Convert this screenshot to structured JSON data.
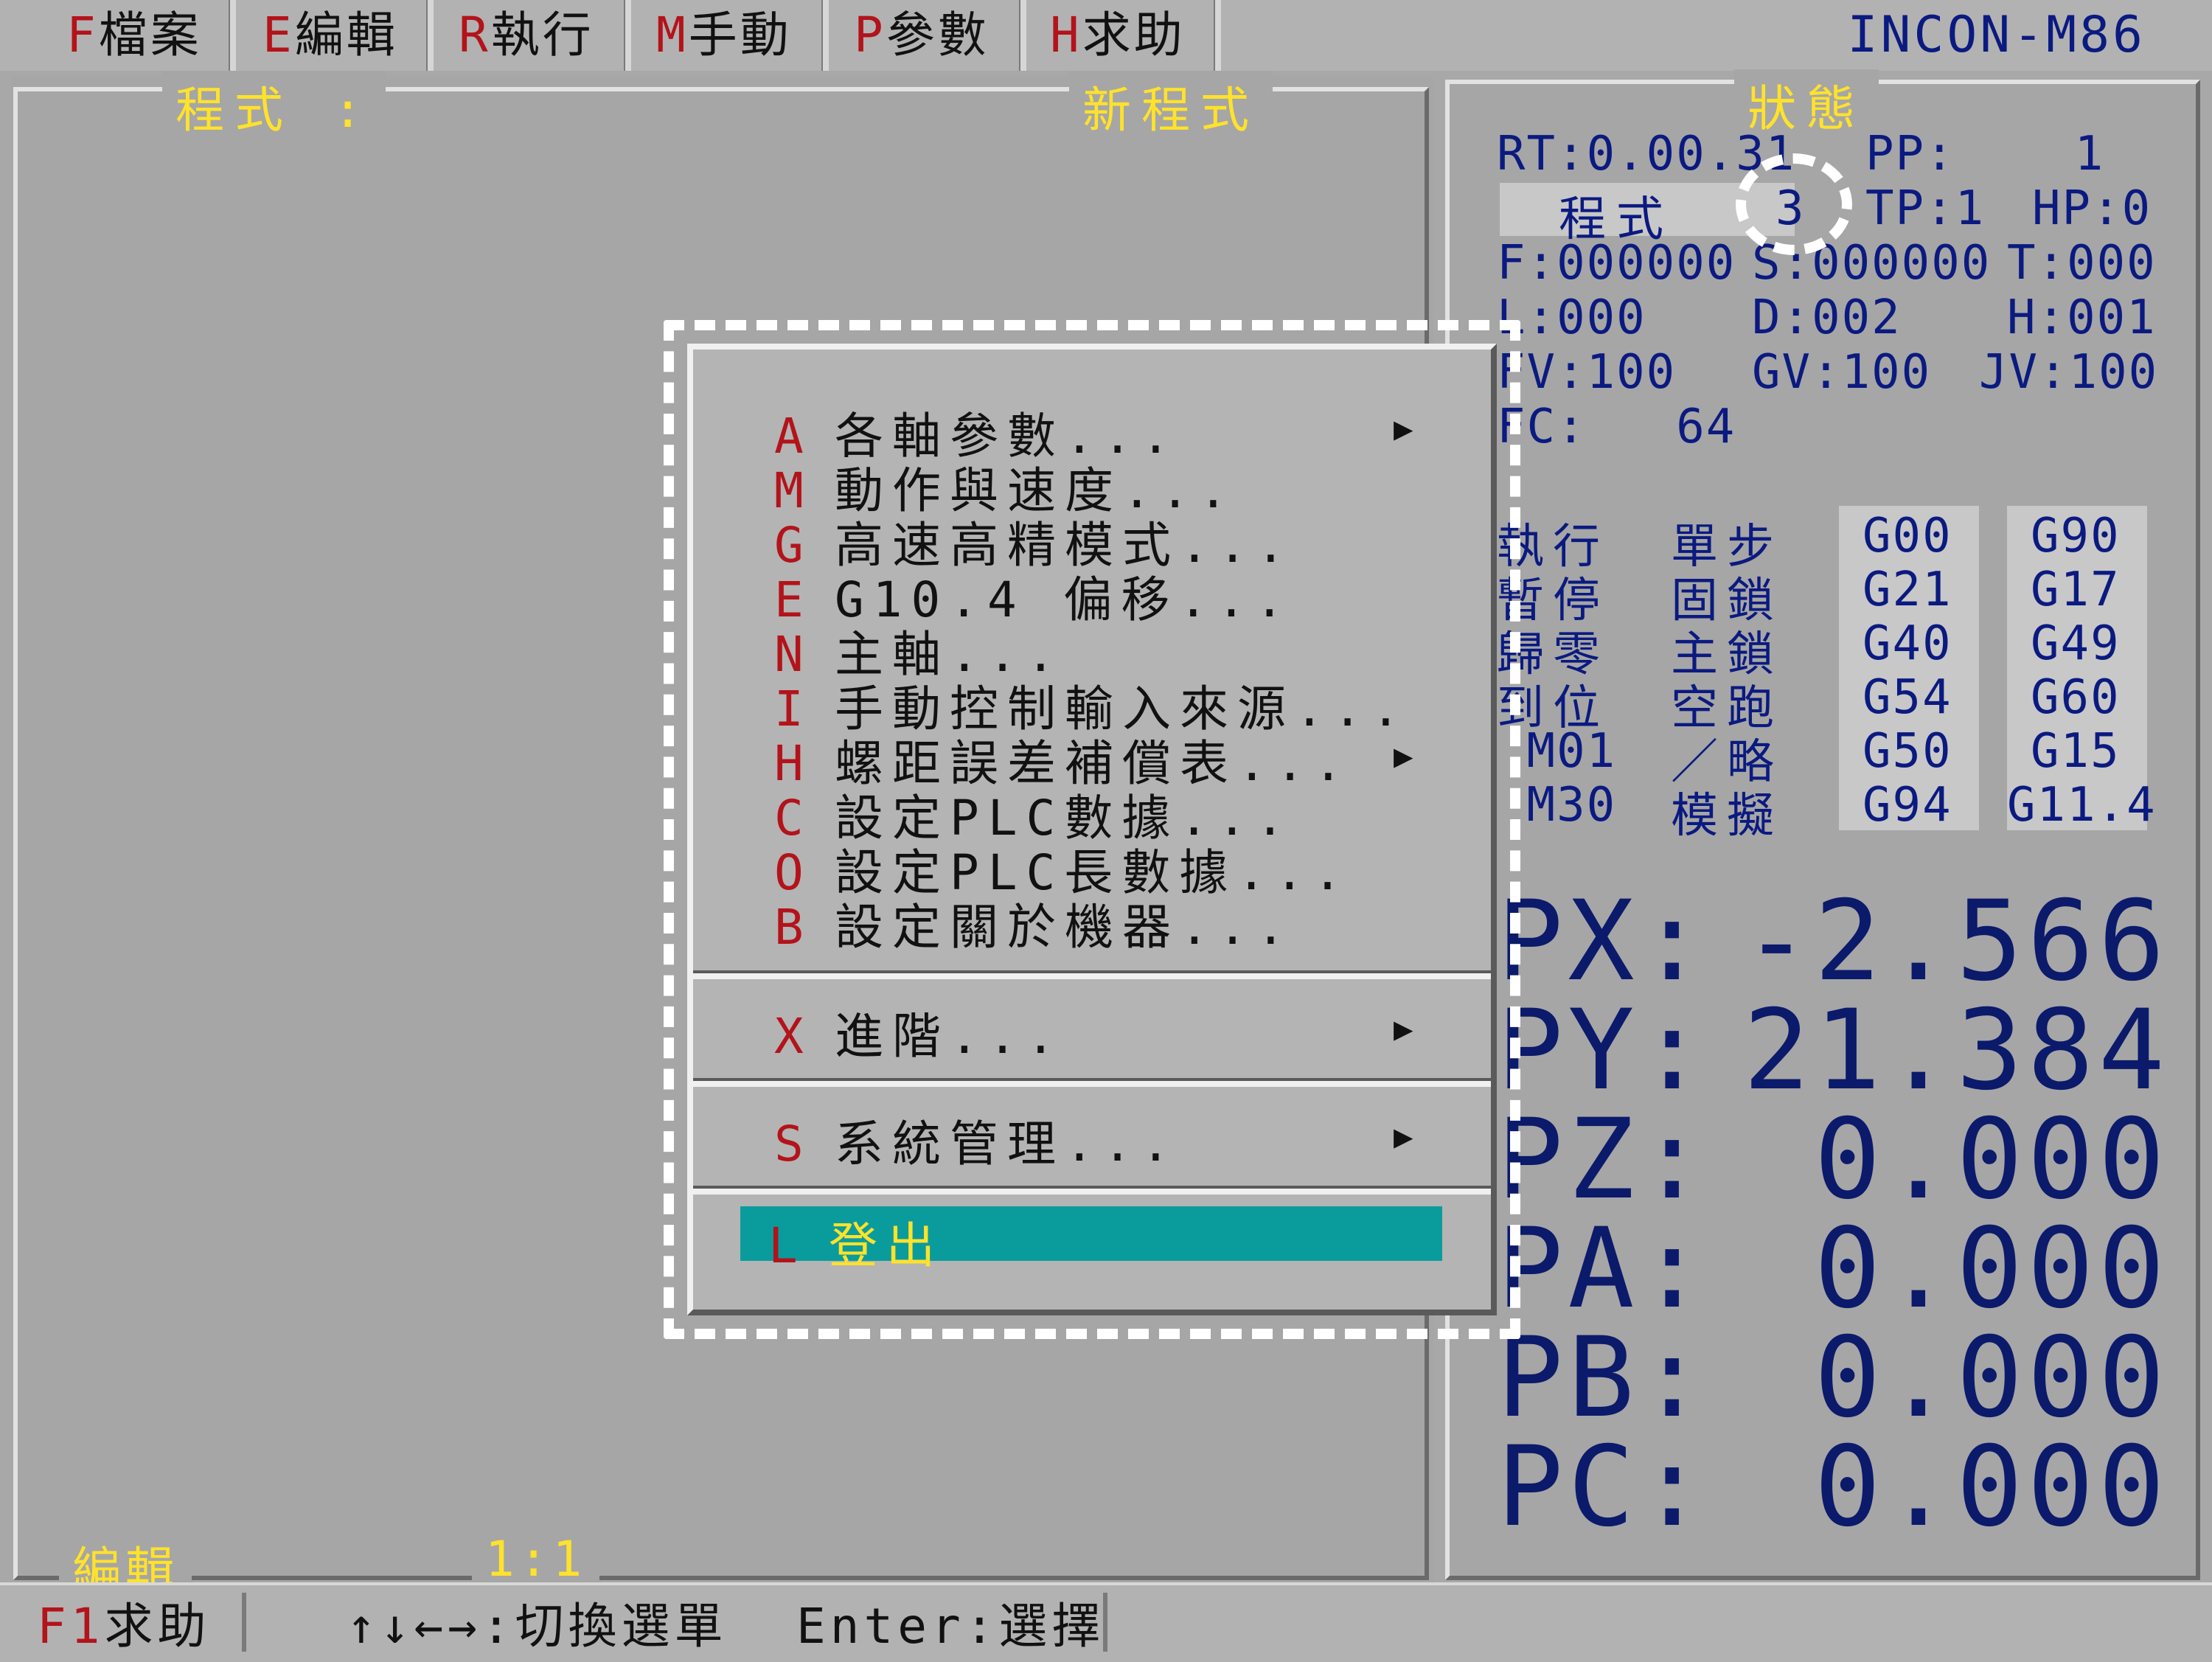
{
  "menubar": {
    "items": [
      {
        "key": "F",
        "label": "檔案"
      },
      {
        "key": "E",
        "label": "編輯"
      },
      {
        "key": "R",
        "label": "執行"
      },
      {
        "key": "M",
        "label": "手動"
      },
      {
        "key": "P",
        "label": "參數"
      },
      {
        "key": "H",
        "label": "求助"
      }
    ],
    "brand": "INCON-M86"
  },
  "program_panel": {
    "label": "程式 :",
    "program_name": "新程式",
    "mode": "編輯",
    "cursor": "1:1"
  },
  "status": {
    "title": "狀態",
    "rt": "RT:0.00.31",
    "pp": "PP:    1",
    "mode_label": "程式",
    "mode_num": "3",
    "tp": "TP:1",
    "hp": "HP:0",
    "f": "F:000000",
    "s": "S:000000",
    "t": "T:000",
    "l": "L:000",
    "d": "D:002",
    "h": "H:001",
    "fv": "FV:100",
    "gv": "GV:100",
    "jv": "JV:100",
    "fc": "FC:   64",
    "flags_left": [
      "執行",
      "暫停",
      "歸零",
      "到位",
      " M01",
      " M30"
    ],
    "flags_mid": [
      "單步",
      "固鎖",
      "主鎖",
      "空跑",
      "／略",
      "模擬"
    ],
    "g_col1": [
      "G00",
      "G21",
      "G40",
      "G54",
      "G50",
      "G94"
    ],
    "g_col2": [
      "G90",
      "G17",
      "G49",
      "G60",
      "G15",
      "G11.4"
    ],
    "axes": [
      {
        "name": "PX:",
        "value": "-2.566"
      },
      {
        "name": "PY:",
        "value": "21.384"
      },
      {
        "name": "PZ:",
        "value": "0.000"
      },
      {
        "name": "PA:",
        "value": "0.000"
      },
      {
        "name": "PB:",
        "value": "0.000"
      },
      {
        "name": "PC:",
        "value": "0.000"
      }
    ]
  },
  "dropdown": {
    "group1": [
      {
        "key": "A",
        "label": "各軸參數...",
        "submenu": true
      },
      {
        "key": "M",
        "label": "動作與速度...",
        "submenu": false
      },
      {
        "key": "G",
        "label": "高速高精模式...",
        "submenu": false
      },
      {
        "key": "E",
        "label": "G10.4 偏移...",
        "submenu": false
      },
      {
        "key": "N",
        "label": "主軸...",
        "submenu": false
      },
      {
        "key": "I",
        "label": "手動控制輸入來源...",
        "submenu": false
      },
      {
        "key": "H",
        "label": "螺距誤差補償表...",
        "submenu": true
      },
      {
        "key": "C",
        "label": "設定PLC數據...",
        "submenu": false
      },
      {
        "key": "O",
        "label": "設定PLC長數據...",
        "submenu": false
      },
      {
        "key": "B",
        "label": "設定關於機器...",
        "submenu": false
      }
    ],
    "advanced": {
      "key": "X",
      "label": "進階...",
      "submenu": true
    },
    "system": {
      "key": "S",
      "label": "系統管理...",
      "submenu": true
    },
    "logout": {
      "key": "L",
      "label": "登出"
    },
    "arrow": "▶"
  },
  "bottombar": {
    "help_key": "F1",
    "help_label": "求助",
    "nav_hint": "↑↓←→:切換選單",
    "enter_hint": "Enter:選擇"
  }
}
